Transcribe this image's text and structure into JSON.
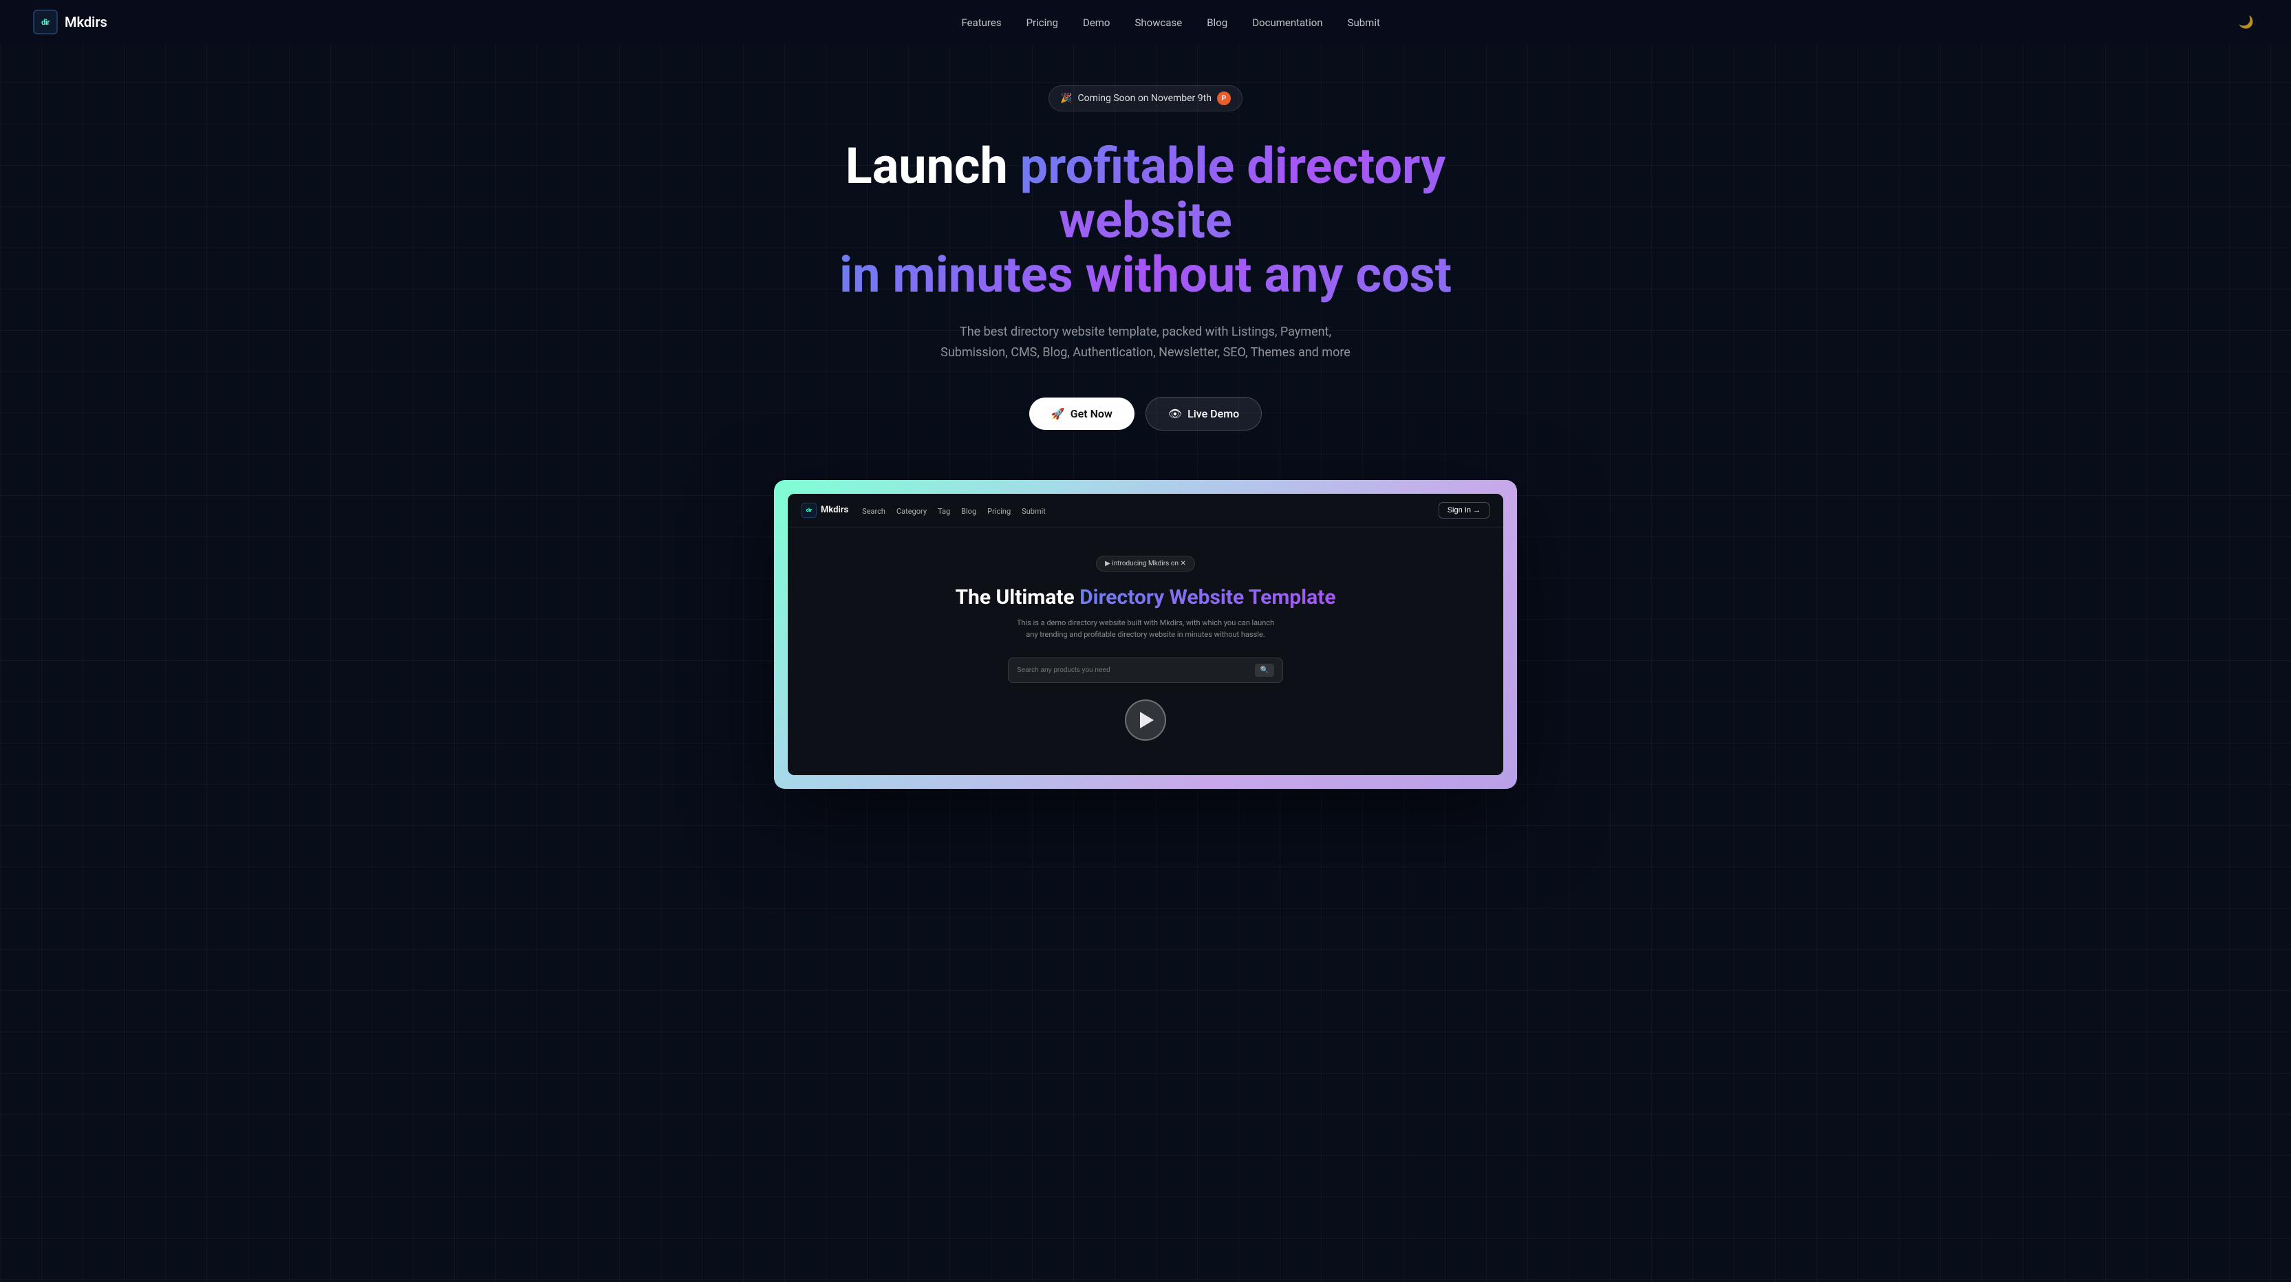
{
  "nav": {
    "logo_icon_text": "dir",
    "logo_text": "Mkdirs",
    "links": [
      {
        "label": "Features",
        "href": "#features"
      },
      {
        "label": "Pricing",
        "href": "#pricing"
      },
      {
        "label": "Demo",
        "href": "#demo"
      },
      {
        "label": "Showcase",
        "href": "#showcase"
      },
      {
        "label": "Blog",
        "href": "#blog"
      },
      {
        "label": "Documentation",
        "href": "#docs"
      },
      {
        "label": "Submit",
        "href": "#submit"
      }
    ],
    "dark_mode_icon": "🌙"
  },
  "hero": {
    "badge_icon": "🎉",
    "badge_text": "Coming Soon on November 9th",
    "badge_dot": "P",
    "title_part1": "Launch ",
    "title_highlight": "profitable directory website",
    "title_part2": " in minutes without any cost",
    "subtitle": "The best directory website template, packed with Listings, Payment, Submission, CMS, Blog, Authentication, Newsletter, SEO, Themes and more",
    "btn_primary_icon": "🚀",
    "btn_primary_label": "Get Now",
    "btn_secondary_icon": "👁",
    "btn_secondary_label": "Live Demo"
  },
  "demo_preview": {
    "nav": {
      "logo_icon": "dir",
      "logo_text": "Mkdirs",
      "links": [
        "Search",
        "Category",
        "Tag",
        "Blog",
        "Pricing",
        "Submit"
      ],
      "sign_in_label": "Sign In →"
    },
    "announcement": "▶  introducing Mkdirs on  ✕",
    "title_part1": "The Ultimate ",
    "title_highlight": "Directory Website Template",
    "subtitle": "This is a demo directory website built with Mkdirs, with which you can launch any trending and profitable directory website in minutes without hassle.",
    "search_placeholder": "Search any products you need",
    "search_btn": "🔍"
  }
}
